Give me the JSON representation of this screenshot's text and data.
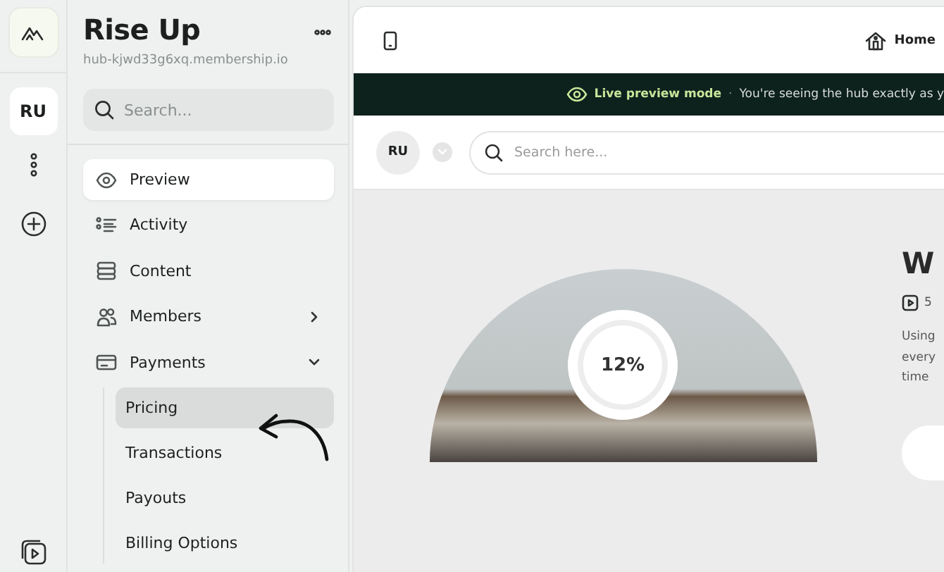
{
  "rail": {
    "avatar": "RU"
  },
  "sidebar": {
    "title": "Rise Up",
    "subtitle": "hub-kjwd33g6xq.membership.io",
    "search": {
      "placeholder": "Search..."
    },
    "items": [
      {
        "label": "Preview",
        "kind": "eye",
        "selected": true
      },
      {
        "label": "Activity",
        "kind": "list",
        "selected": false
      },
      {
        "label": "Content",
        "kind": "stack",
        "selected": false
      },
      {
        "label": "Members",
        "kind": "people",
        "selected": false,
        "expanded": false
      },
      {
        "label": "Payments",
        "kind": "card",
        "selected": false,
        "expanded": true,
        "children": [
          {
            "label": "Pricing",
            "selected": true
          },
          {
            "label": "Transactions",
            "selected": false
          },
          {
            "label": "Payouts",
            "selected": false
          },
          {
            "label": "Billing Options",
            "selected": false
          }
        ]
      }
    ]
  },
  "preview": {
    "nav": {
      "home": "Home"
    },
    "banner": {
      "mode": "Live preview mode",
      "separator": "·",
      "message": "You're seeing the hub exactly as y"
    },
    "header": {
      "avatar": "RU",
      "search": {
        "placeholder": "Search here..."
      }
    },
    "course": {
      "progress": "12%",
      "title": "W",
      "meta": "5",
      "description": [
        "Using",
        "every",
        "time"
      ]
    }
  }
}
